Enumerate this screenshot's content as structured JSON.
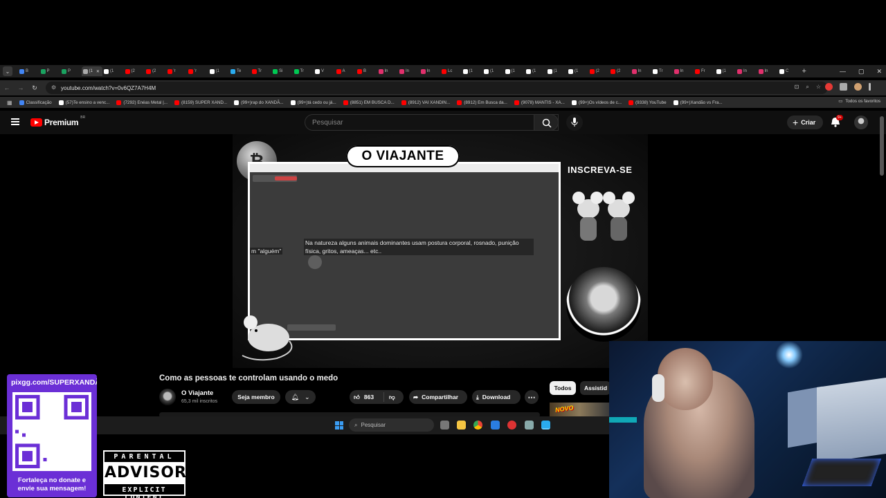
{
  "browser": {
    "tabs": [
      {
        "label": "B",
        "color": "#4285f4"
      },
      {
        "label": "P",
        "color": "#1aa260"
      },
      {
        "label": "P",
        "color": "#1aa260"
      },
      {
        "label": "(1",
        "color": "#aaaaaa"
      },
      {
        "label": "(1",
        "color": "#ffffff"
      },
      {
        "label": "(2",
        "color": "#ff0000"
      },
      {
        "label": "(2",
        "color": "#ff0000"
      },
      {
        "label": "'r",
        "color": "#ff0000"
      },
      {
        "label": "'r",
        "color": "#ff0000"
      },
      {
        "label": "(1",
        "color": "#ffffff"
      },
      {
        "label": "Te",
        "color": "#2aabee"
      },
      {
        "label": "Tr",
        "color": "#ff0000"
      },
      {
        "label": "Si",
        "color": "#00c853"
      },
      {
        "label": "Tr",
        "color": "#00c853"
      },
      {
        "label": "V",
        "color": "#ffffff"
      },
      {
        "label": "A",
        "color": "#ff0000"
      },
      {
        "label": "B",
        "color": "#ff0000"
      },
      {
        "label": "In",
        "color": "#e1306c"
      },
      {
        "label": "In",
        "color": "#e1306c"
      },
      {
        "label": "In",
        "color": "#e1306c"
      },
      {
        "label": "Lc",
        "color": "#ff0000"
      },
      {
        "label": "(1",
        "color": "#ffffff"
      },
      {
        "label": "(1",
        "color": "#ffffff"
      },
      {
        "label": "(1",
        "color": "#ffffff"
      },
      {
        "label": "(1",
        "color": "#ffffff"
      },
      {
        "label": "(1",
        "color": "#ffffff"
      },
      {
        "label": "(1",
        "color": "#ffffff"
      },
      {
        "label": "(2",
        "color": "#ff0000"
      },
      {
        "label": "(2",
        "color": "#ff0000"
      },
      {
        "label": "In",
        "color": "#e1306c"
      },
      {
        "label": "Tr",
        "color": "#ffffff"
      },
      {
        "label": "In",
        "color": "#e1306c"
      },
      {
        "label": "Fr",
        "color": "#ff0000"
      },
      {
        "label": "(1",
        "color": "#ffffff"
      },
      {
        "label": "In",
        "color": "#e1306c"
      },
      {
        "label": "In",
        "color": "#e1306c"
      },
      {
        "label": "C",
        "color": "#ffffff"
      }
    ],
    "active_tab_index": 3,
    "url": "youtube.com/watch?v=0v6QZ7A7H4M",
    "bookmarks": [
      {
        "label": "Classificação",
        "color": "#4285f4"
      },
      {
        "label": "(57)Te ensino a venc...",
        "color": "#ffffff"
      },
      {
        "label": "(7292) Enéas Metal |...",
        "color": "#ff0000"
      },
      {
        "label": "(8159) SUPER XAND...",
        "color": "#ff0000"
      },
      {
        "label": "(99+)rap do XANDÃ...",
        "color": "#ffffff"
      },
      {
        "label": "(99+)tá cedo ou já...",
        "color": "#ffffff"
      },
      {
        "label": "(8851) EM BUSCA D...",
        "color": "#ff0000"
      },
      {
        "label": "(8912) VAI XANDIN...",
        "color": "#ff0000"
      },
      {
        "label": "(8912) Em Busca da...",
        "color": "#ff0000"
      },
      {
        "label": "(9078) MANTIS - XA...",
        "color": "#ff0000"
      },
      {
        "label": "(99+)Os vídeos de c...",
        "color": "#ffffff"
      },
      {
        "label": "(9338) YouTube",
        "color": "#ff0000"
      },
      {
        "label": "(99+)Xandão vs Fra...",
        "color": "#ffffff"
      }
    ],
    "all_bookmarks": "Todos os favoritos"
  },
  "youtube": {
    "brand": "Premium",
    "region": "BR",
    "search_placeholder": "Pesquisar",
    "create_label": "Criar",
    "notif_badge": "9+",
    "video": {
      "overlay_title": "O VIAJANTE",
      "subscribe_text": "INSCREVA-SE",
      "caption_left": "m \"alguém\"",
      "caption": "Na natureza alguns animais dominantes usam postura corporal, rosnado, punição física, gritos, ameaças... etc.."
    },
    "title": "Como as pessoas te controlam usando o medo",
    "channel": "O Viajante",
    "subscribers": "65,3 mil inscritos",
    "join_label": "Seja membro",
    "likes": "863",
    "share_label": "Compartilhar",
    "download_label": "Download",
    "chips": [
      "Todos",
      "Assistid"
    ],
    "thumb_text": "NOVO"
  },
  "taskbar": {
    "search_placeholder": "Pesquisar"
  },
  "overlays": {
    "pix_url": "pixgg.com/SUPERXANDÃ",
    "pix_msg_1": "Fortaleça no donate e",
    "pix_msg_2": "envie sua mensagem!",
    "advisory_1": "PARENTAL",
    "advisory_2": "ADVISORY",
    "advisory_3": "EXPLICIT CONTENT"
  },
  "colors": {
    "youtube_red": "#ff0000",
    "pix_purple": "#6b2fd6",
    "chip_active_bg": "#f1f1f1"
  }
}
